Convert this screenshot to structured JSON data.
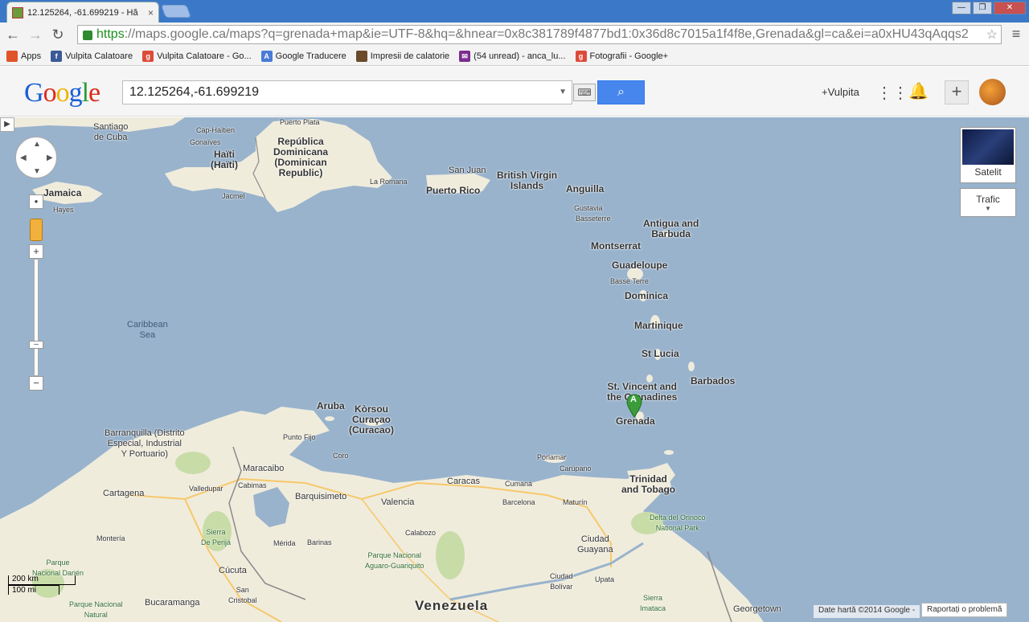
{
  "browser": {
    "tab_title": "12.125264, -61.699219 - Hă",
    "tab_close": "×",
    "url_https": "https",
    "url_host": "://maps.google.ca",
    "url_rest": "/maps?q=grenada+map&ie=UTF-8&hq=&hnear=0x8c381789f4877bd1:0x36d8c7015a1f4f8e,Grenada&gl=ca&ei=a0xHU43qAqqs2",
    "window_controls": [
      "—",
      "❐",
      "✕"
    ]
  },
  "bookmarks": [
    {
      "label": "Apps",
      "icon": "apps-icon",
      "color": "#e0542a"
    },
    {
      "label": "Vulpita Calatoare",
      "icon": "facebook-icon",
      "color": "#3b5998"
    },
    {
      "label": "Vulpita Calatoare - Go...",
      "icon": "google-plus-icon",
      "color": "#dd4b39"
    },
    {
      "label": "Google Traducere",
      "icon": "translate-icon",
      "color": "#4a7bd6"
    },
    {
      "label": "Impresii de calatorie",
      "icon": "photo-icon",
      "color": "#6b4a2a"
    },
    {
      "label": "(54 unread) - anca_lu...",
      "icon": "mail-icon",
      "color": "#7b2d8f"
    },
    {
      "label": "Fotografii - Google+",
      "icon": "google-plus-icon",
      "color": "#dd4b39"
    }
  ],
  "header": {
    "logo": [
      "G",
      "o",
      "o",
      "g",
      "l",
      "e"
    ],
    "search_value": "12.125264,-61.699219",
    "user": "+Vulpita"
  },
  "map_controls": {
    "satellite_label": "Satelit",
    "traffic_label": "Trafic",
    "scale_km": "200 km",
    "scale_mi": "100 mi",
    "attribution": "Date hartă ©2014 Google -",
    "report": "Raportați o problemă"
  },
  "marker": {
    "label": "A",
    "color": "#3a9d3a"
  },
  "labels": {
    "santiago": "Santiago\nde Cuba",
    "cap_haitien": "Cap-Haïtien",
    "gonaives": "Gonaïves",
    "haiti": "Haïti\n(Haïti)",
    "puerto_plata": "Puerto Plata",
    "rep_dom": "República\nDominicana\n(Dominican\nRepublic)",
    "jacmel": "Jacmel",
    "la_romana": "La Romana",
    "jamaica": "Jamaica",
    "hayes": "Hayes",
    "san_juan": "San Juan",
    "puerto_rico": "Puerto Rico",
    "bvi": "British Virgin\nIslands",
    "anguilla": "Anguilla",
    "gustavia": "Gustavia",
    "basseterre": "Basseterre",
    "antigua": "Antigua and\nBarbuda",
    "montserrat": "Montserrat",
    "guadeloupe": "Guadeloupe",
    "basse_terre": "Basse Terre",
    "dominica": "Dominica",
    "martinique": "Martinique",
    "st_lucia": "St Lucia",
    "barbados": "Barbados",
    "svg": "St. Vincent and\nthe Grenadines",
    "grenada": "Grenada",
    "caribbean_sea": "Caribbean\nSea",
    "aruba": "Aruba",
    "curacao": "Kòrsou\nCuraçao\n(Curacao)",
    "punto_fijo": "Punto Fijo",
    "coro": "Coro",
    "barranquilla": "Barranquilla (Distrito\nEspecial, Industrial\nY Portuario)",
    "cartagena": "Cartagena",
    "valledupar": "Valledupar",
    "maracaibo": "Maracaibo",
    "cabimas": "Cabimas",
    "barquisimeto": "Barquisimeto",
    "valencia": "Valencia",
    "caracas": "Caracas",
    "cumana": "Cumaná",
    "carupano": "Carúpano",
    "porlamar": "Porlamar",
    "trinidad": "Trinidad\nand Tobago",
    "barcelona": "Barcelona",
    "maturin": "Maturín",
    "delta": "Delta del Orinoco\nNational Park",
    "monteria": "Montería",
    "sierra_perija": "Sierra\nDe Perijá",
    "merida": "Mérida",
    "barinas": "Barinas",
    "calabozo": "Calabozo",
    "aguaro": "Parque Nacional\nAguaro-Guariquito",
    "ciudad_guayana": "Ciudad\nGuayana",
    "ciudad_bolivar": "Ciudad\nBolívar",
    "upata": "Upata",
    "cucuta": "Cúcuta",
    "san_cristobal": "San\nCristobal",
    "bucaramanga": "Bucaramanga",
    "parque_darien": "Parque\nNacional Darién",
    "parque_nacional": "Parque Nacional\nNatural",
    "venezuela": "Venezuela",
    "sierra_imataca": "Sierra\nImataca",
    "georgetown": "Georgetown"
  },
  "colors": {
    "water": "#99b3cc",
    "land": "#f0ecdc",
    "park": "#c8dca8",
    "road": "#f6c86a",
    "border": "#8a8a8a",
    "search_button": "#4787ed"
  }
}
